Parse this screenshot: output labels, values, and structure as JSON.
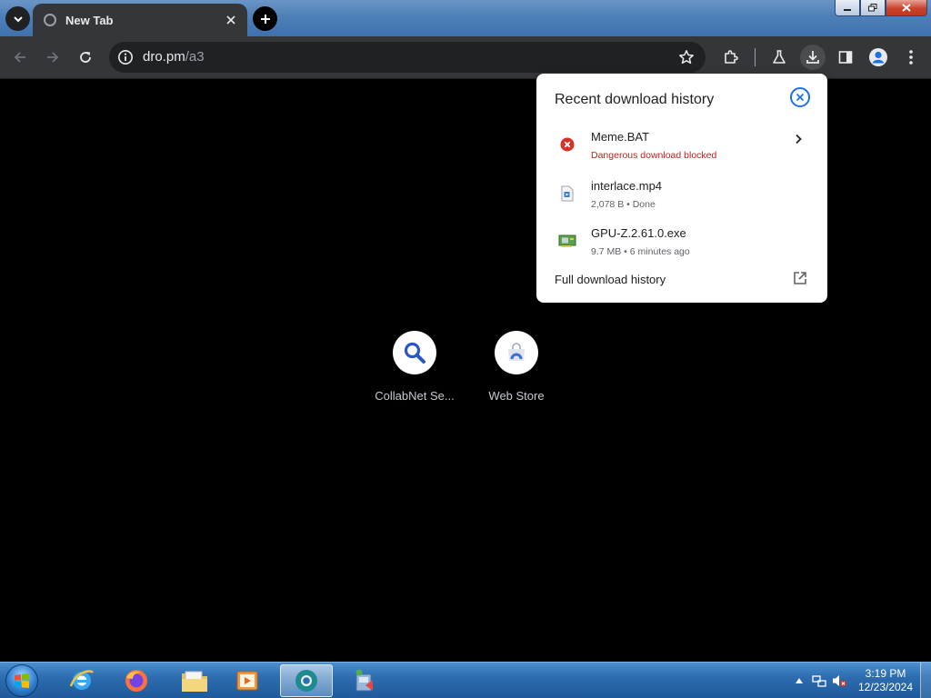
{
  "browser": {
    "tab": {
      "title": "New Tab"
    },
    "omnibox": {
      "url_host": "dro.pm",
      "url_path": "/a3"
    }
  },
  "downloads": {
    "title": "Recent download history",
    "items": [
      {
        "name": "Meme.BAT",
        "status": "Dangerous download blocked",
        "icon": "error-icon",
        "status_color": "#c5221f"
      },
      {
        "name": "interlace.mp4",
        "status": "2,078 B • Done",
        "icon": "video-file-icon"
      },
      {
        "name": "GPU-Z.2.61.0.exe",
        "status": "9.7 MB • 6 minutes ago",
        "icon": "gpu-card-icon"
      }
    ],
    "full_history_label": "Full download history"
  },
  "shortcuts": [
    {
      "label": "CollabNet Se...",
      "icon": "search-icon"
    },
    {
      "label": "Web Store",
      "icon": "web-store-icon"
    }
  ],
  "taskbar": {
    "apps": [
      "internet-explorer-icon",
      "firefox-icon",
      "file-explorer-icon",
      "media-player-icon",
      "chrome-canary-icon",
      "installer-icon"
    ],
    "clock": {
      "time": "3:19 PM",
      "date": "12/23/2024"
    }
  },
  "colors": {
    "accent": "#1a73e8",
    "danger": "#c5221f",
    "toolbar_bg": "#35363a",
    "omnibox_bg": "#202124"
  }
}
